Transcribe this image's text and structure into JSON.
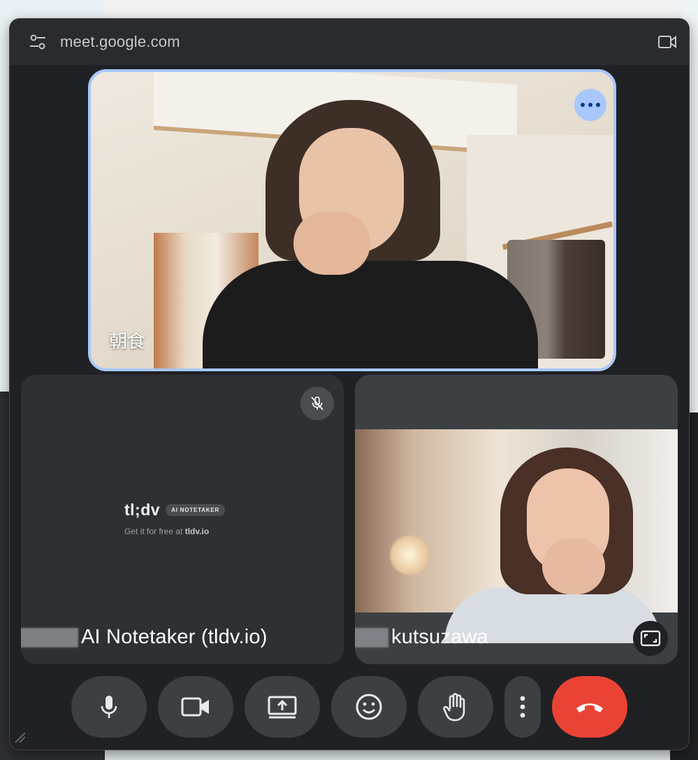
{
  "window": {
    "url": "meet.google.com"
  },
  "main_tile": {
    "participant_name": "朝食"
  },
  "tiles": [
    {
      "participant_name": "AI Notetaker (tldv.io)",
      "brand_logo": "tl;dv",
      "brand_badge": "AI NOTETAKER",
      "brand_tagline_prefix": "Get it for free at",
      "brand_tagline_link": "tldv.io",
      "muted": true
    },
    {
      "participant_name": "kutsuzawa"
    }
  ],
  "controls": {
    "buttons": [
      "microphone",
      "camera",
      "present-screen",
      "reactions",
      "raise-hand",
      "more-options",
      "leave-call"
    ]
  },
  "colors": {
    "active_speaker_border": "#a8c7fa",
    "leave_button": "#ea4335",
    "control_button": "#3c4043",
    "window_bg": "#202124"
  },
  "icons": [
    "tune-icon",
    "video-camera-icon",
    "more-horiz-icon",
    "mic-off-icon",
    "expand-icon",
    "mic-icon",
    "videocam-icon",
    "present-to-all-icon",
    "emoji-icon",
    "hand-icon",
    "more-vert-icon",
    "call-end-icon"
  ]
}
